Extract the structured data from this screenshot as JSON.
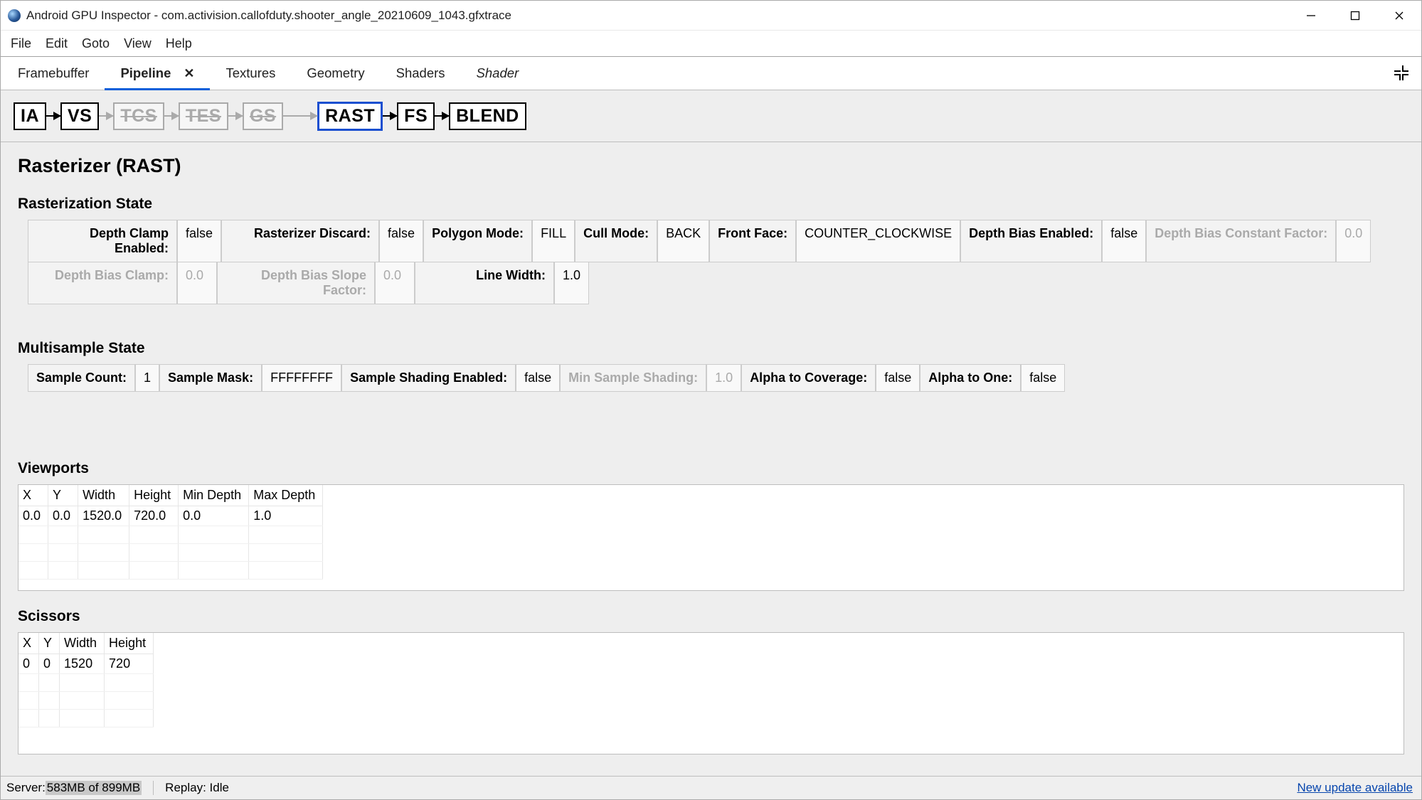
{
  "window": {
    "title": "Android GPU Inspector - com.activision.callofduty.shooter_angle_20210609_1043.gfxtrace"
  },
  "menu": {
    "file": "File",
    "edit": "Edit",
    "goto": "Goto",
    "view": "View",
    "help": "Help"
  },
  "tabs": {
    "framebuffer": "Framebuffer",
    "pipeline": "Pipeline",
    "textures": "Textures",
    "geometry": "Geometry",
    "shaders": "Shaders",
    "shader": "Shader"
  },
  "stages": {
    "ia": "IA",
    "vs": "VS",
    "tcs": "TCS",
    "tes": "TES",
    "gs": "GS",
    "rast": "RAST",
    "fs": "FS",
    "blend": "BLEND"
  },
  "heading": "Rasterizer (RAST)",
  "raster_state": {
    "title": "Rasterization State",
    "depth_clamp_enabled": {
      "label": "Depth Clamp Enabled:",
      "value": "false"
    },
    "rasterizer_discard": {
      "label": "Rasterizer Discard:",
      "value": "false"
    },
    "polygon_mode": {
      "label": "Polygon Mode:",
      "value": "FILL"
    },
    "cull_mode": {
      "label": "Cull Mode:",
      "value": "BACK"
    },
    "front_face": {
      "label": "Front Face:",
      "value": "COUNTER_CLOCKWISE"
    },
    "depth_bias_enabled": {
      "label": "Depth Bias Enabled:",
      "value": "false"
    },
    "depth_bias_constant": {
      "label": "Depth Bias Constant Factor:",
      "value": "0.0"
    },
    "depth_bias_clamp": {
      "label": "Depth Bias Clamp:",
      "value": "0.0"
    },
    "depth_bias_slope": {
      "label": "Depth Bias Slope Factor:",
      "value": "0.0"
    },
    "line_width": {
      "label": "Line Width:",
      "value": "1.0"
    }
  },
  "multisample": {
    "title": "Multisample State",
    "sample_count": {
      "label": "Sample Count:",
      "value": "1"
    },
    "sample_mask": {
      "label": "Sample Mask:",
      "value": "FFFFFFFF"
    },
    "sample_shading_enabled": {
      "label": "Sample Shading Enabled:",
      "value": "false"
    },
    "min_sample_shading": {
      "label": "Min Sample Shading:",
      "value": "1.0"
    },
    "alpha_to_coverage": {
      "label": "Alpha to Coverage:",
      "value": "false"
    },
    "alpha_to_one": {
      "label": "Alpha to One:",
      "value": "false"
    }
  },
  "viewports": {
    "title": "Viewports",
    "headers": {
      "x": "X",
      "y": "Y",
      "w": "Width",
      "h": "Height",
      "mind": "Min Depth",
      "maxd": "Max Depth"
    },
    "rows": [
      {
        "x": "0.0",
        "y": "0.0",
        "w": "1520.0",
        "h": "720.0",
        "mind": "0.0",
        "maxd": "1.0"
      }
    ]
  },
  "scissors": {
    "title": "Scissors",
    "headers": {
      "x": "X",
      "y": "Y",
      "w": "Width",
      "h": "Height"
    },
    "rows": [
      {
        "x": "0",
        "y": "0",
        "w": "1520",
        "h": "720"
      }
    ]
  },
  "status": {
    "server_label": "Server: ",
    "server_used": "583MB of ",
    "server_total": "899MB",
    "replay": "Replay: Idle",
    "update": "New update available"
  }
}
